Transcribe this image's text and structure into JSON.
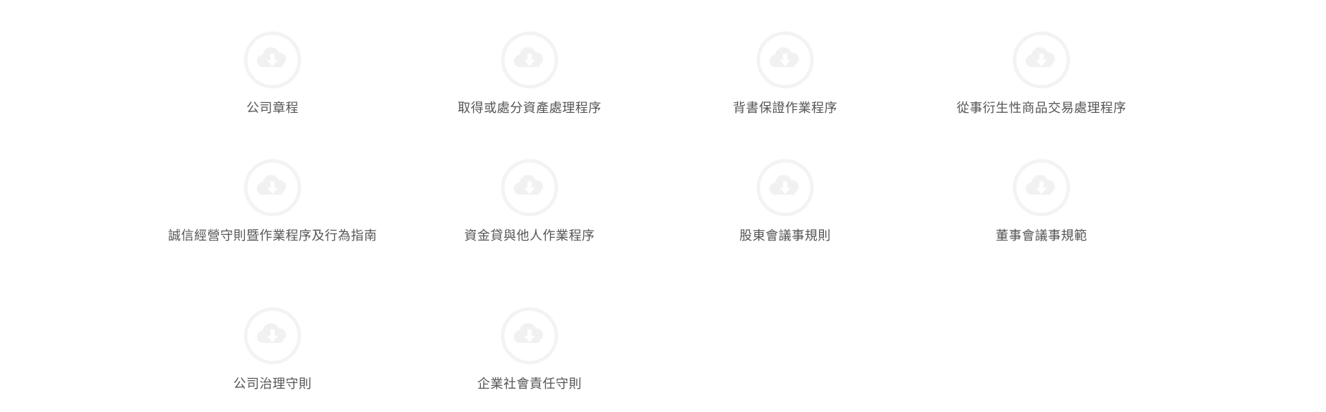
{
  "documents": [
    {
      "label": "公司章程",
      "icon": "cloud-download-icon"
    },
    {
      "label": "取得或處分資產處理程序",
      "icon": "cloud-download-icon"
    },
    {
      "label": "背書保證作業程序",
      "icon": "cloud-download-icon"
    },
    {
      "label": "從事衍生性商品交易處理程序",
      "icon": "cloud-download-icon"
    },
    {
      "label": "誠信經營守則暨作業程序及行為指南",
      "icon": "cloud-download-icon"
    },
    {
      "label": "資金貸與他人作業程序",
      "icon": "cloud-download-icon"
    },
    {
      "label": "股東會議事規則",
      "icon": "cloud-download-icon"
    },
    {
      "label": "董事會議事規範",
      "icon": "cloud-download-icon"
    },
    {
      "label": "公司治理守則",
      "icon": "cloud-download-icon"
    },
    {
      "label": "企業社會責任守則",
      "icon": "cloud-download-icon"
    }
  ],
  "colors": {
    "label_text": "#555555",
    "icon_ring": "#f3f3f3",
    "icon_cloud": "#f1f1f1",
    "icon_arrow": "#ffffff",
    "background": "#ffffff"
  }
}
